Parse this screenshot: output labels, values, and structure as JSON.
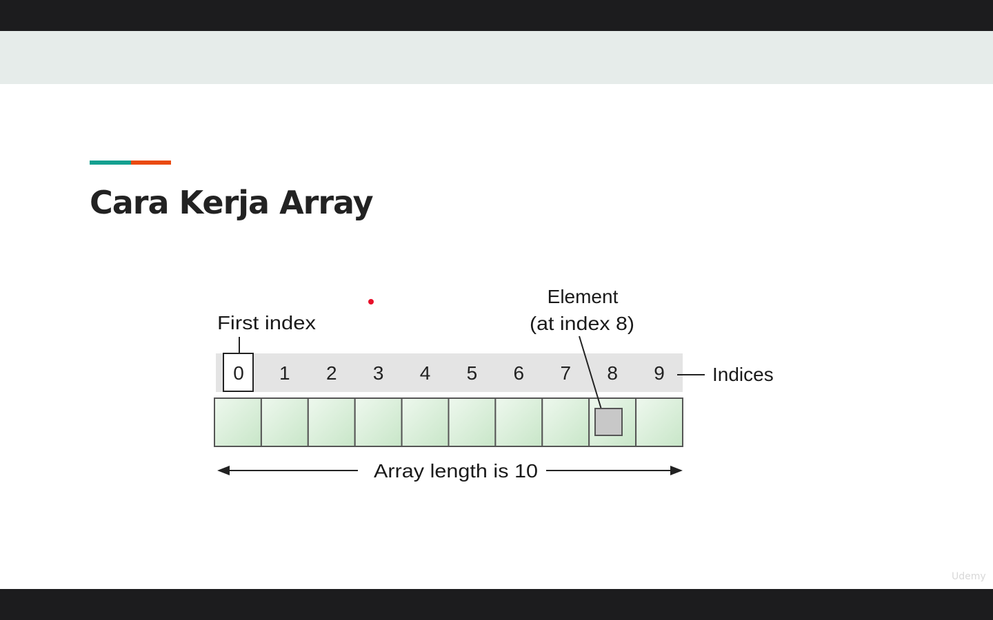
{
  "slide": {
    "title": "Cara Kerja Array",
    "accent_colors": {
      "teal": "#14a090",
      "orange": "#ea4a10"
    },
    "laser_pointer_color": "#e8102a",
    "watermark": "Udemy"
  },
  "diagram": {
    "first_index_label": "First index",
    "element_label_line1": "Element",
    "element_label_line2": "(at index 8)",
    "indices_label": "Indices",
    "length_label": "Array length is 10",
    "indices": [
      "0",
      "1",
      "2",
      "3",
      "4",
      "5",
      "6",
      "7",
      "8",
      "9"
    ],
    "highlighted_index": 8,
    "colors": {
      "index_band": "#e4e4e4",
      "cell_fill_light": "#eef8ee",
      "cell_fill_dark": "#c8e6c8",
      "cell_border": "#555555",
      "element_fill": "#c8c8c8"
    }
  }
}
